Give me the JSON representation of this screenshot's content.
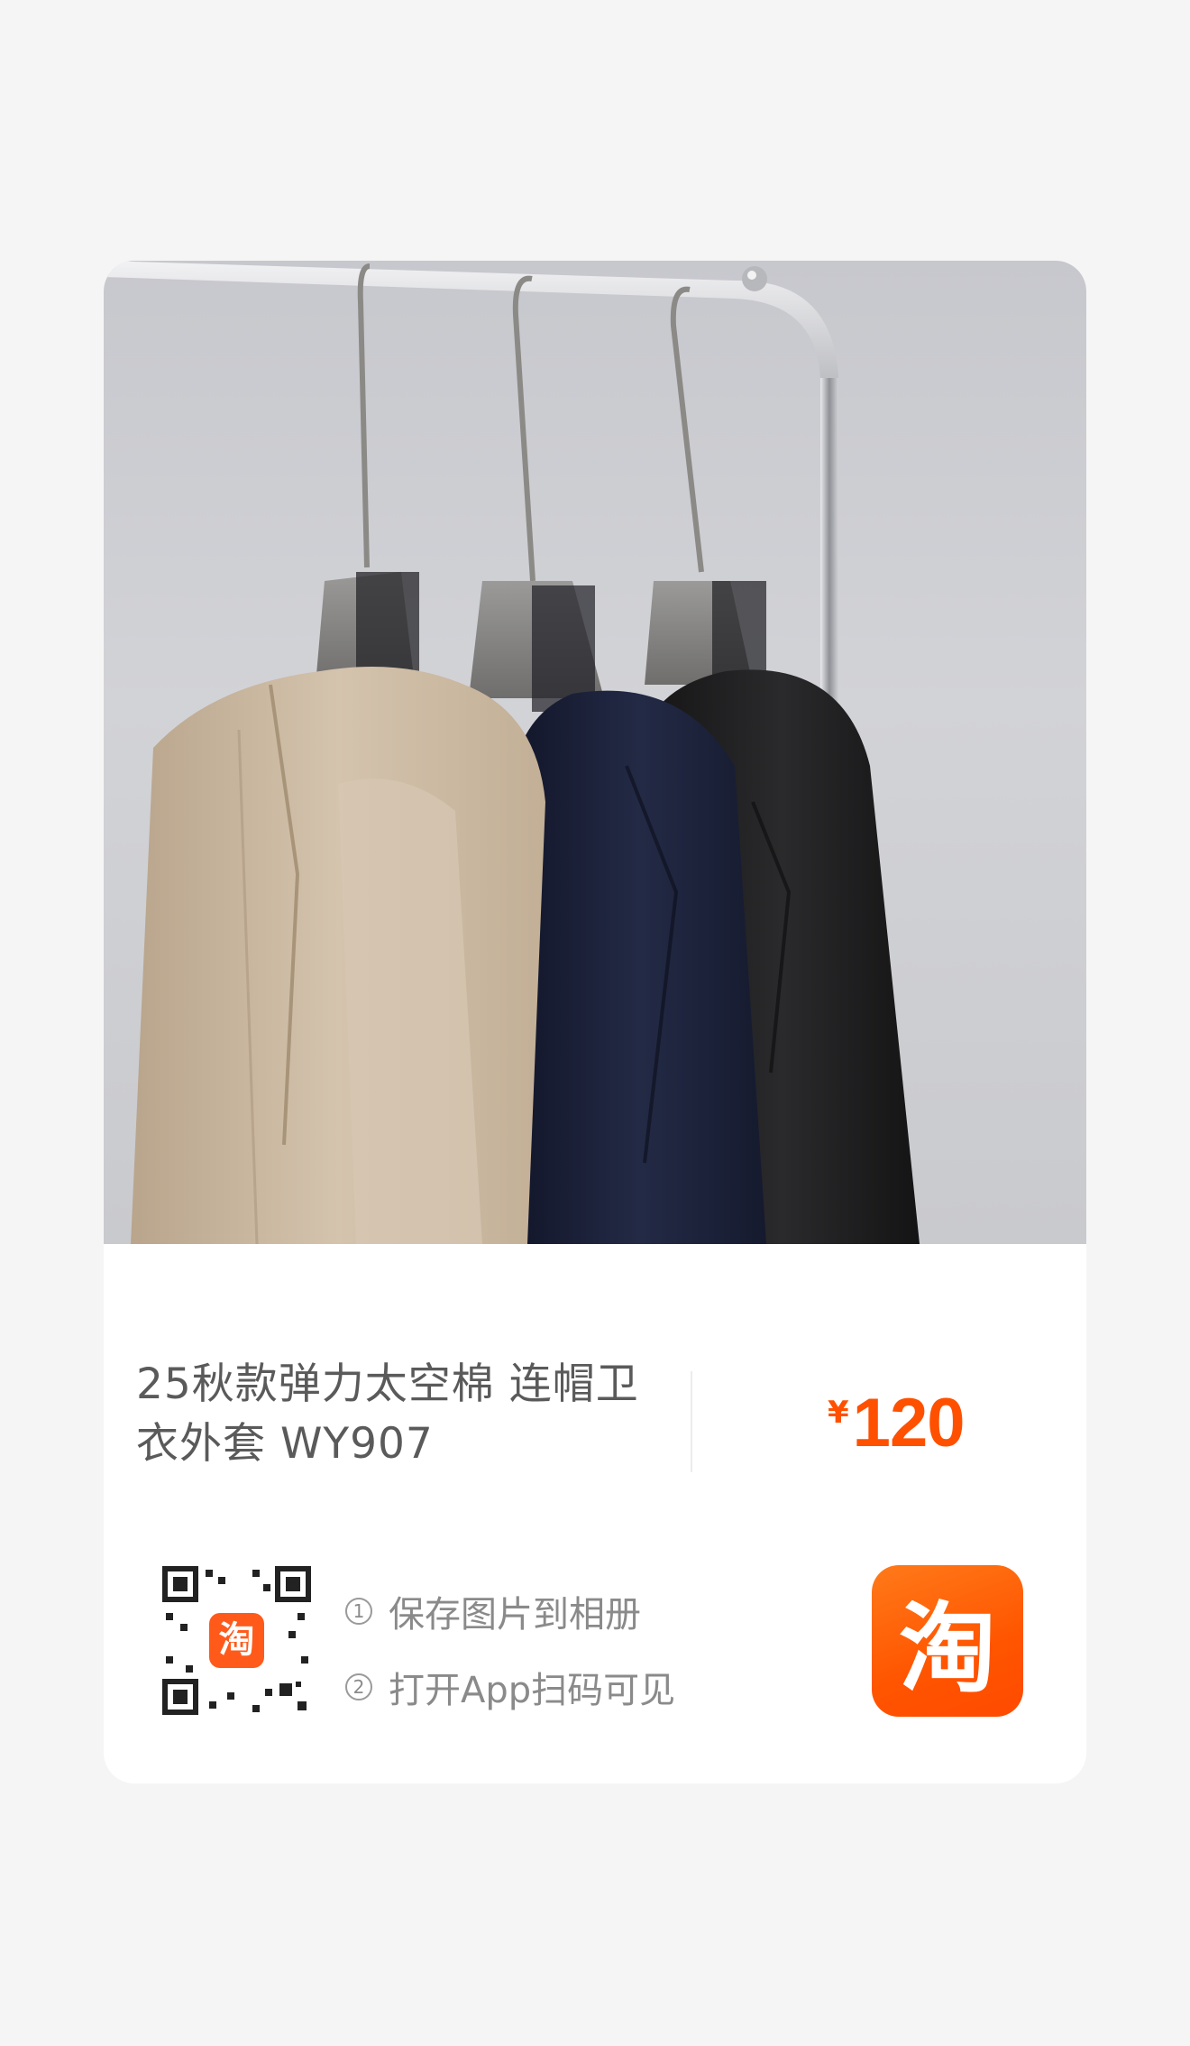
{
  "product": {
    "title": "25秋款弹力太空棉 连帽卫衣外套 WY907",
    "price_symbol": "¥",
    "price": "120"
  },
  "steps": [
    {
      "number": "1",
      "text": "保存图片到相册"
    },
    {
      "number": "2",
      "text": "打开App扫码可见"
    }
  ],
  "logo": {
    "text": "淘",
    "qr_badge_text": "淘"
  },
  "colors": {
    "accent": "#ff5000",
    "logo_bg": "#ff5a00",
    "hoodie_beige": "#cbb8a0",
    "hoodie_navy": "#1a1f33",
    "hoodie_black": "#1c1c1e"
  },
  "icons": {
    "qr_code": "qr-code-icon",
    "taobao_logo": "taobao-logo-icon",
    "step_badge": "circled-number-icon"
  }
}
